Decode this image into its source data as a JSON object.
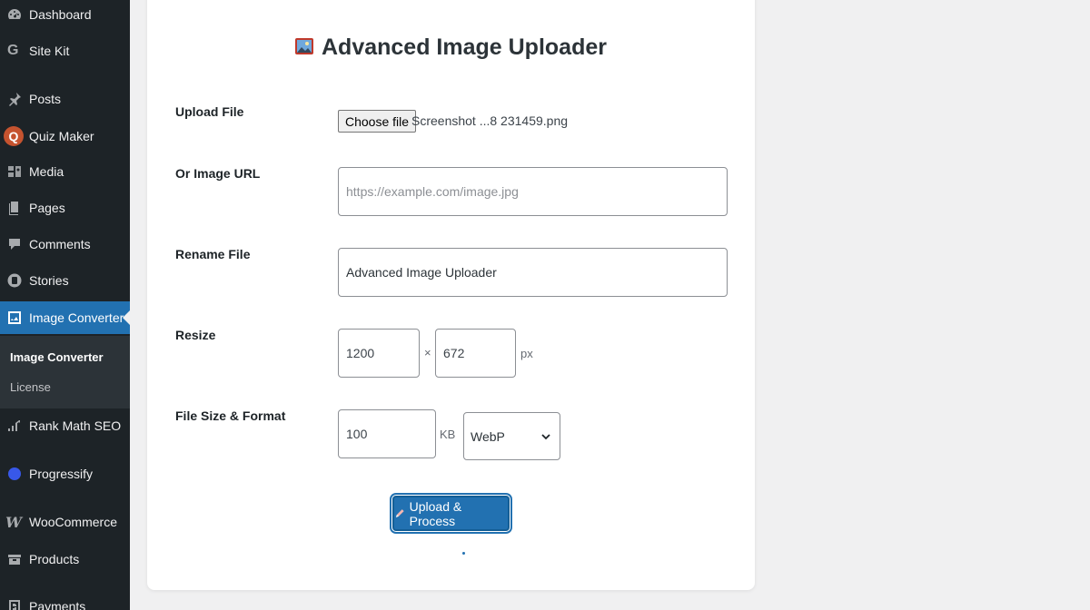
{
  "sidebar": {
    "items": [
      {
        "label": "Dashboard",
        "icon": "dashboard-icon"
      },
      {
        "label": "Site Kit",
        "icon": "google-g-icon"
      },
      {
        "label": "Posts",
        "icon": "pin-icon"
      },
      {
        "label": "Quiz Maker",
        "icon": "quiz-maker-icon"
      },
      {
        "label": "Media",
        "icon": "media-icon"
      },
      {
        "label": "Pages",
        "icon": "pages-icon"
      },
      {
        "label": "Comments",
        "icon": "comments-icon"
      },
      {
        "label": "Stories",
        "icon": "stories-icon"
      },
      {
        "label": "Image Converter",
        "icon": "image-converter-icon",
        "active": true
      },
      {
        "label": "Rank Math SEO",
        "icon": "rank-math-icon"
      },
      {
        "label": "Progressify",
        "icon": "progressify-icon"
      },
      {
        "label": "WooCommerce",
        "icon": "woocommerce-icon"
      },
      {
        "label": "Products",
        "icon": "products-icon"
      },
      {
        "label": "Payments",
        "icon": "payments-icon"
      }
    ],
    "submenu": [
      {
        "label": "Image Converter",
        "current": true
      },
      {
        "label": "License"
      }
    ]
  },
  "form": {
    "title": "Advanced Image Uploader",
    "upload_label": "Upload File",
    "choose_file_label": "Choose file",
    "file_name": "Screenshot ...8 231459.png",
    "url_label": "Or Image URL",
    "url_placeholder": "https://example.com/image.jpg",
    "rename_label": "Rename File",
    "rename_value": "Advanced Image Uploader",
    "resize_label": "Resize",
    "width_value": "1200",
    "times_sign": "×",
    "height_value": "672",
    "px_unit": "px",
    "size_format_label": "File Size & Format",
    "size_value": "100",
    "kb_unit": "KB",
    "format_selected": "WebP",
    "submit_label": "Upload & Process"
  },
  "colors": {
    "sidebar_bg": "#1d2327",
    "accent": "#2271b1",
    "page_bg": "#f0f0f1"
  }
}
